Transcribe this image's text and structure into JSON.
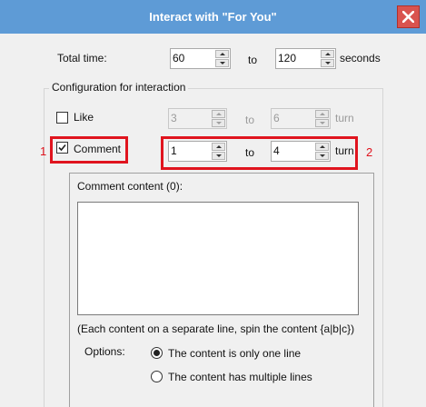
{
  "window": {
    "title": "Interact with \"For You\""
  },
  "total_time": {
    "label": "Total time:",
    "from": "60",
    "to_label": "to",
    "to": "120",
    "unit": "seconds"
  },
  "config": {
    "legend": "Configuration for interaction",
    "like": {
      "label": "Like",
      "checked": false,
      "from": "3",
      "to_label": "to",
      "to": "6",
      "unit": "turn"
    },
    "comment": {
      "label": "Comment",
      "checked": true,
      "from": "1",
      "to_label": "to",
      "to": "4",
      "unit": "turn"
    },
    "comment_content": {
      "label": "Comment content (0):",
      "value": "",
      "hint": "(Each content on a separate line, spin the content {a|b|c})",
      "options_label": "Options:",
      "options": [
        "The content is only one line",
        "The content has multiple lines"
      ],
      "selected_option": "The content is only one line"
    }
  },
  "annotations": {
    "marker_1": "1",
    "marker_2": "2",
    "color": "#e0141e"
  },
  "colors": {
    "titlebar": "#5e9bd6",
    "close": "#d9534f"
  }
}
